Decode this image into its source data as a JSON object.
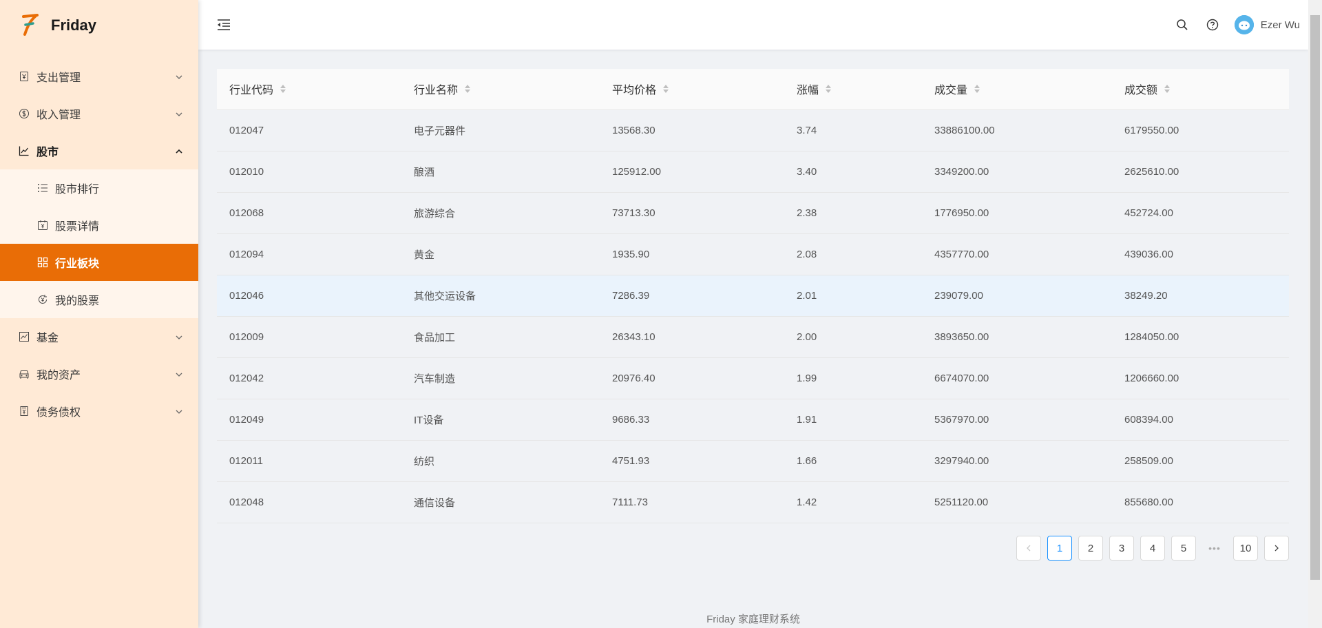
{
  "app": {
    "name": "Friday"
  },
  "colors": {
    "accent": "#e96d06",
    "sidebar_bg": "#ffead6",
    "link": "#1890ff"
  },
  "sidebar": {
    "items": [
      {
        "label": "支出管理",
        "icon": "receipt-icon"
      },
      {
        "label": "收入管理",
        "icon": "dollar-circle-icon"
      },
      {
        "label": "股市",
        "icon": "line-chart-icon",
        "open": true,
        "children": [
          {
            "label": "股市排行",
            "icon": "ordered-list-icon"
          },
          {
            "label": "股票详情",
            "icon": "calendar-yen-icon"
          },
          {
            "label": "行业板块",
            "icon": "appstore-icon",
            "active": true
          },
          {
            "label": "我的股票",
            "icon": "refresh-yen-icon"
          }
        ]
      },
      {
        "label": "基金",
        "icon": "stock-chart-icon"
      },
      {
        "label": "我的资产",
        "icon": "car-icon"
      },
      {
        "label": "债务债权",
        "icon": "debt-icon"
      }
    ]
  },
  "header": {
    "user_name": "Ezer Wu"
  },
  "table": {
    "columns": [
      "行业代码",
      "行业名称",
      "平均价格",
      "涨幅",
      "成交量",
      "成交额"
    ],
    "rows": [
      [
        "012047",
        "电子元器件",
        "13568.30",
        "3.74",
        "33886100.00",
        "6179550.00"
      ],
      [
        "012010",
        "酿酒",
        "125912.00",
        "3.40",
        "3349200.00",
        "2625610.00"
      ],
      [
        "012068",
        "旅游综合",
        "73713.30",
        "2.38",
        "1776950.00",
        "452724.00"
      ],
      [
        "012094",
        "黄金",
        "1935.90",
        "2.08",
        "4357770.00",
        "439036.00"
      ],
      [
        "012046",
        "其他交运设备",
        "7286.39",
        "2.01",
        "239079.00",
        "38249.20"
      ],
      [
        "012009",
        "食品加工",
        "26343.10",
        "2.00",
        "3893650.00",
        "1284050.00"
      ],
      [
        "012042",
        "汽车制造",
        "20976.40",
        "1.99",
        "6674070.00",
        "1206660.00"
      ],
      [
        "012049",
        "IT设备",
        "9686.33",
        "1.91",
        "5367970.00",
        "608394.00"
      ],
      [
        "012011",
        "纺织",
        "4751.93",
        "1.66",
        "3297940.00",
        "258509.00"
      ],
      [
        "012048",
        "通信设备",
        "7111.73",
        "1.42",
        "5251120.00",
        "855680.00"
      ]
    ]
  },
  "pagination": {
    "pages": [
      "1",
      "2",
      "3",
      "4",
      "5"
    ],
    "last": "10",
    "current": "1",
    "ellipsis": "•••"
  },
  "footer": {
    "text": "Friday 家庭理财系统"
  }
}
